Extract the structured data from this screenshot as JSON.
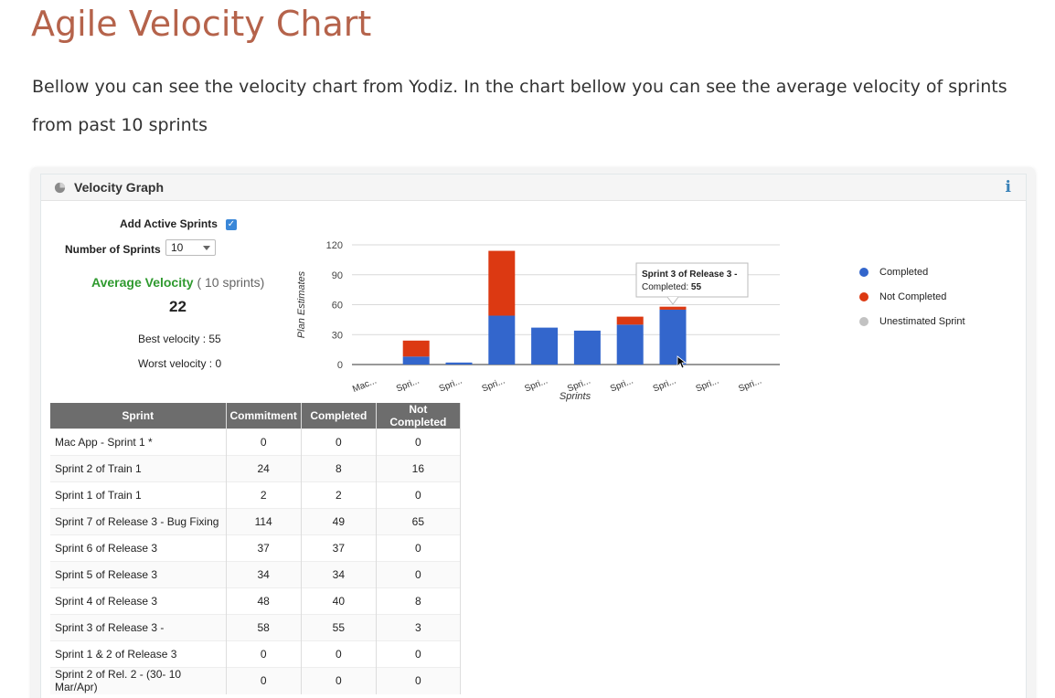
{
  "page": {
    "title": "Agile Velocity Chart",
    "intro": "Bellow you can see the velocity chart from Yodiz. In the chart bellow you can see the average velocity of sprints from past 10 sprints"
  },
  "widget": {
    "title": "Velocity Graph",
    "add_active_sprints_label": "Add Active Sprints",
    "add_active_sprints_checked": true,
    "number_of_sprints_label": "Number of Sprints",
    "number_of_sprints_value": "10",
    "average_velocity_label": "Average Velocity",
    "average_velocity_note": "( 10 sprints)",
    "average_velocity_value": "22",
    "best_velocity": "Best velocity : 55",
    "worst_velocity": "Worst velocity : 0"
  },
  "colors": {
    "completed": "#3366cc",
    "not_completed": "#dc3912",
    "unestimated": "#c2c2c2",
    "title": "#b5634b",
    "accent_green": "#2f9a2f"
  },
  "chart_data": {
    "type": "bar",
    "stacked": true,
    "categories": [
      "Mac...",
      "Spri...",
      "Spri...",
      "Spri...",
      "Spri...",
      "Spri...",
      "Spri...",
      "Spri...",
      "Spri...",
      "Spri..."
    ],
    "series": [
      {
        "name": "Completed",
        "values": [
          0,
          8,
          2,
          49,
          37,
          34,
          40,
          55,
          0,
          0
        ]
      },
      {
        "name": "Not Completed",
        "values": [
          0,
          16,
          0,
          65,
          0,
          0,
          8,
          3,
          0,
          0
        ]
      },
      {
        "name": "Unestimated Sprint",
        "values": [
          0,
          0,
          0,
          0,
          0,
          0,
          0,
          0,
          0,
          0
        ]
      }
    ],
    "xlabel": "Sprints",
    "ylabel": "Plan Estimates",
    "ylim": [
      0,
      120
    ],
    "yticks": [
      0,
      30,
      60,
      90,
      120
    ],
    "grid": true,
    "legend": "right",
    "tooltip": {
      "title": "Sprint 3 of Release 3 -",
      "label": "Completed:",
      "value": "55"
    }
  },
  "table": {
    "headers": [
      "Sprint",
      "Commitment",
      "Completed",
      "Not Completed"
    ],
    "rows": [
      [
        "Mac App - Sprint 1 *",
        "0",
        "0",
        "0"
      ],
      [
        "Sprint 2 of Train 1",
        "24",
        "8",
        "16"
      ],
      [
        "Sprint 1 of Train 1",
        "2",
        "2",
        "0"
      ],
      [
        "Sprint 7 of Release 3 - Bug Fixing",
        "114",
        "49",
        "65"
      ],
      [
        "Sprint 6 of Release 3",
        "37",
        "37",
        "0"
      ],
      [
        "Sprint 5 of Release 3",
        "34",
        "34",
        "0"
      ],
      [
        "Sprint 4 of Release 3",
        "48",
        "40",
        "8"
      ],
      [
        "Sprint 3 of Release 3 -",
        "58",
        "55",
        "3"
      ],
      [
        "Sprint 1 & 2 of Release 3",
        "0",
        "0",
        "0"
      ],
      [
        "Sprint 2 of Rel. 2 - (30- 10 Mar/Apr)",
        "0",
        "0",
        "0"
      ]
    ]
  }
}
